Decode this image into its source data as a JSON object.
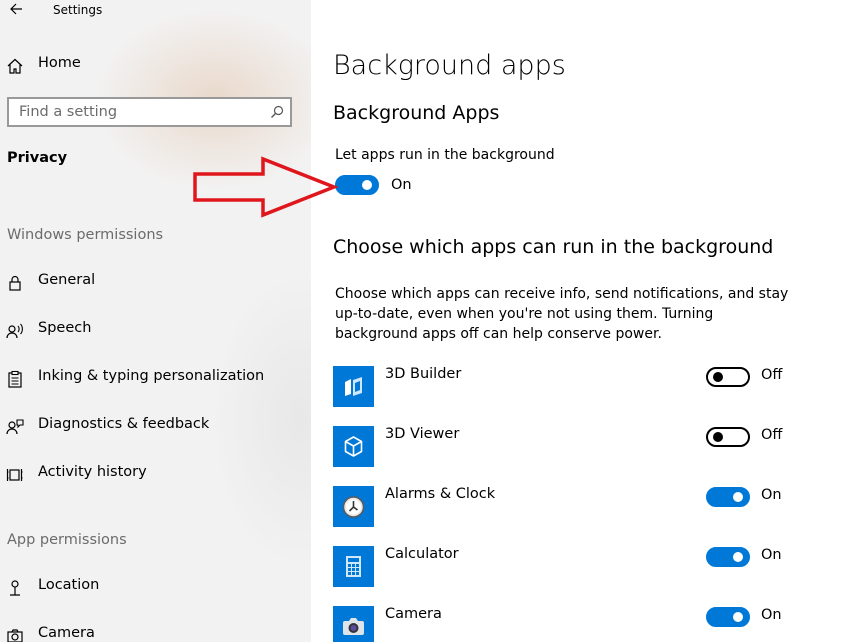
{
  "window": {
    "title": "Settings"
  },
  "sidebar": {
    "home_label": "Home",
    "search": {
      "placeholder": "Find a setting"
    },
    "category": "Privacy",
    "windows_permissions": {
      "heading": "Windows permissions",
      "items": [
        {
          "label": "General",
          "icon": "lock-icon"
        },
        {
          "label": "Speech",
          "icon": "speech-icon"
        },
        {
          "label": "Inking & typing personalization",
          "icon": "clipboard-icon"
        },
        {
          "label": "Diagnostics & feedback",
          "icon": "feedback-icon"
        },
        {
          "label": "Activity history",
          "icon": "activity-history-icon"
        }
      ]
    },
    "app_permissions": {
      "heading": "App permissions",
      "items": [
        {
          "label": "Location",
          "icon": "location-icon"
        },
        {
          "label": "Camera",
          "icon": "camera-icon"
        }
      ]
    }
  },
  "main": {
    "title": "Background apps",
    "subhead": "Background Apps",
    "master_setting": {
      "label": "Let apps run in the background",
      "state": "On",
      "enabled": true
    },
    "section_title": "Choose which apps can run in the background",
    "description": "Choose which apps can receive info, send notifications, and stay up-to-date, even when you're not using them. Turning background apps off can help conserve power.",
    "apps": [
      {
        "name": "3D Builder",
        "state": "Off",
        "enabled": false,
        "icon": "3d-builder-icon"
      },
      {
        "name": "3D Viewer",
        "state": "Off",
        "enabled": false,
        "icon": "3d-viewer-icon"
      },
      {
        "name": "Alarms & Clock",
        "state": "On",
        "enabled": true,
        "icon": "alarm-clock-icon"
      },
      {
        "name": "Calculator",
        "state": "On",
        "enabled": true,
        "icon": "calculator-icon"
      },
      {
        "name": "Camera",
        "state": "On",
        "enabled": true,
        "icon": "camera-app-icon"
      }
    ]
  },
  "colors": {
    "accent": "#0078d7",
    "annotation_arrow": "#e0161d",
    "sidebar_bg": "#f2f2f2"
  }
}
